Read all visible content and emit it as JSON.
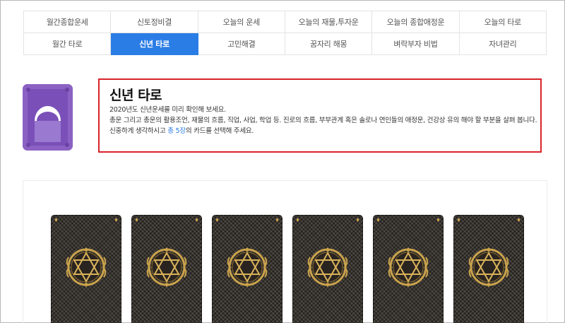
{
  "nav": {
    "row1": [
      "월간종합운세",
      "신토정비결",
      "오늘의 운세",
      "오늘의 재물,투자운",
      "오늘의 종합애정운",
      "오늘의 타로"
    ],
    "row2": [
      "월간 타로",
      "신년 타로",
      "고민해결",
      "꿈자리 해몽",
      "벼락부자 비법",
      "자녀관리"
    ],
    "active_label": "신년 타로"
  },
  "intro": {
    "title": "신년 타로",
    "line1": "2020년도 신년운세를 미리 확인해 보세요.",
    "line2": "총운 그리고 총운의 활용조언, 재물의 흐름, 직업, 사업, 학업 등. 진로의 흐름, 부부관계 혹은 솔로나 연인들의 애정운, 건강상 유의 해야 할 부분을 살펴 봅니다.",
    "line3_pre": "신중하게 생각하시고 ",
    "line3_highlight": "총 5장",
    "line3_post": "의 카드를 선택해 주세요."
  },
  "product_icon": "moon-card-icon",
  "cards": {
    "icon": "hexagram-emblem-icon",
    "visible_count": 6
  },
  "colors": {
    "accent": "#2b7de6",
    "highlight_border": "#d9232b",
    "icon_bg": "#8b62c4",
    "card_gold": "#c9a24b"
  }
}
